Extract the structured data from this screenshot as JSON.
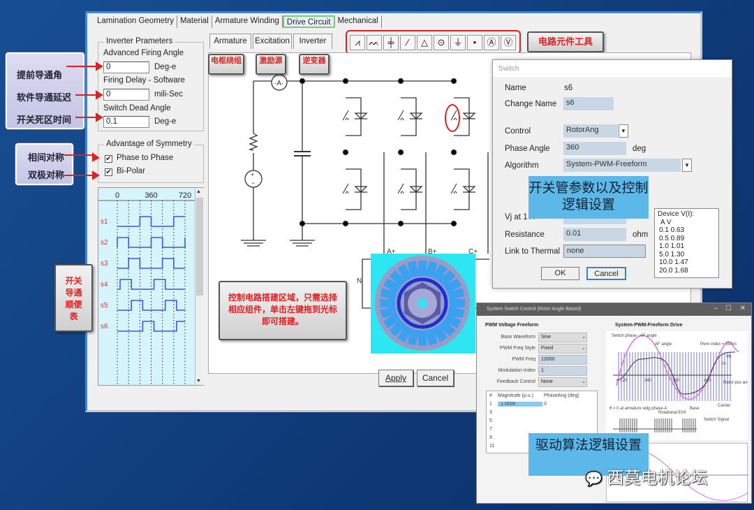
{
  "tabs": [
    {
      "label": "Lamination Geometry"
    },
    {
      "label": "Material"
    },
    {
      "label": "Armature Winding"
    },
    {
      "label": "Drive Circuit",
      "active": true
    },
    {
      "label": "Mechanical"
    }
  ],
  "inverter": {
    "title": "Inverter Prameters",
    "adv_label": "Advanced Firing Angle",
    "adv_value": "0",
    "adv_unit": "Deg-e",
    "delay_label": "Firing Delay - Software",
    "delay_value": "0",
    "delay_unit": "mili-Sec",
    "dead_label": "Switch Dead Angle",
    "dead_value": "0.1",
    "dead_unit": "Deg-e"
  },
  "symmetry": {
    "title": "Advantage of Symmetry",
    "phase_label": "Phase to Phase",
    "phase_checked": true,
    "bipolar_label": "Bi-Polar",
    "bipolar_checked": true
  },
  "switch_table": {
    "ticks": [
      "0",
      "360",
      "720"
    ],
    "rows": [
      {
        "name": "s1",
        "on": [
          [
            240,
            360
          ],
          [
            600,
            720
          ]
        ]
      },
      {
        "name": "s2",
        "on": [
          [
            0,
            120
          ],
          [
            360,
            480
          ],
          [
            720,
            720
          ]
        ]
      },
      {
        "name": "s3",
        "on": [
          [
            120,
            240
          ],
          [
            480,
            600
          ]
        ]
      },
      {
        "name": "s4",
        "on": [
          [
            30,
            150
          ],
          [
            390,
            510
          ]
        ]
      },
      {
        "name": "s5",
        "on": [
          [
            150,
            270
          ],
          [
            510,
            630
          ]
        ]
      },
      {
        "name": "s6",
        "on": [
          [
            270,
            390
          ],
          [
            630,
            720
          ]
        ]
      }
    ],
    "wave_color": "#3a5ad8"
  },
  "subtabs": [
    {
      "label": "Armature"
    },
    {
      "label": "Excitation"
    },
    {
      "label": "Inverter"
    }
  ],
  "subtab_callouts": [
    "电枢绕组",
    "激励源",
    "逆变器"
  ],
  "tools": [
    {
      "icon": "resistor-icon",
      "glyph": "⩘"
    },
    {
      "icon": "inductor-icon",
      "glyph": "ᨓ"
    },
    {
      "icon": "capacitor-icon",
      "glyph": "╪"
    },
    {
      "icon": "switch-icon",
      "glyph": "⁄"
    },
    {
      "icon": "diode-icon",
      "glyph": "△"
    },
    {
      "icon": "voltage-source-icon",
      "glyph": "⊙"
    },
    {
      "icon": "ground-icon",
      "glyph": "⏚"
    },
    {
      "icon": "node-icon",
      "glyph": "•"
    },
    {
      "icon": "ammeter-icon",
      "glyph": "Ⓐ"
    },
    {
      "icon": "voltmeter-icon",
      "glyph": "Ⓥ"
    }
  ],
  "tool_callout": "电路元件工具",
  "circuit": {
    "ammeter": "A",
    "terminals": [
      "A+",
      "B+",
      "C+"
    ],
    "neutral": "N"
  },
  "canvas_callout": "控制电路搭建区域，只需选择相应组件，单击左键拖到光标即可搭建。",
  "apply_label": "Apply",
  "cancel_label": "Cancel",
  "left_callouts": {
    "group1": [
      "提前导通角",
      "软件导通延迟",
      "开关死区时间"
    ],
    "group2": [
      "相间对称",
      "双极对称"
    ],
    "group3": "开关导通顺便表"
  },
  "switch_dialog": {
    "title": "Switch",
    "name_label": "Name",
    "name_value": "s6",
    "change_label": "Change Name",
    "change_value": "s6",
    "control_label": "Control",
    "control_value": "RotorAng",
    "phase_label": "Phase Angle",
    "phase_value": "360",
    "phase_unit": "deg",
    "algo_label": "Algorithm",
    "algo_value": "System-PWM-Freeform",
    "vj_label": "Vj at 1 A",
    "res_label": "Resistance",
    "res_value": "0.01",
    "res_unit": "ohm",
    "thermal_label": "Link to Thermal",
    "thermal_value": "none",
    "ok": "OK",
    "cancel": "Cancel",
    "device_title": "Device V(I):",
    "device_header": "A   V",
    "device_rows": [
      "0.1  0.63",
      "0.5  0.89",
      "1.0  1.01",
      "5.0  1.30",
      "10.0  1.47",
      "20.0  1.68"
    ]
  },
  "overlay1": "开关管参数以及控制逻辑设置",
  "ssc": {
    "title": "System Switch Control (Rotor Angle Based)",
    "left_title": "PWM Voltage Freeform",
    "fields": [
      {
        "label": "Base Waveform",
        "value": "Sine",
        "dropdown": true
      },
      {
        "label": "PWM Freq Style",
        "value": "Fixed",
        "dropdown": true
      },
      {
        "label": "PWM Freq",
        "value": "12000",
        "dropdown": false
      },
      {
        "label": "Modulation Index",
        "value": "1",
        "dropdown": false
      },
      {
        "label": "Feedback Control",
        "value": "None",
        "dropdown": true
      }
    ],
    "table_headers": [
      "#",
      "Magnitude (p.u.)",
      "PhaseAng (deg)"
    ],
    "table_rows": [
      [
        "1",
        "1.0000",
        "0"
      ],
      [
        "3",
        "",
        ""
      ],
      [
        "5",
        "",
        ""
      ],
      [
        "7",
        "",
        ""
      ],
      [
        "9",
        "",
        ""
      ],
      [
        "11",
        "",
        ""
      ]
    ],
    "right_title": "System-PWM-Freeform Drive",
    "diagram_labels": {
      "a": "Switch phase - AF angle",
      "b": "AF angle",
      "c": "Pwm index = Vb/Vc",
      "d": "Vb",
      "e": "Vc",
      "f": "Rotor pos angle, θ",
      "g": "θ = 0 at armature wdg phase-A",
      "h": "Rotational Emf",
      "i": "Base",
      "j": "Carrier",
      "k": "Switch Signal",
      "t1": "120",
      "t2": "240",
      "t3": "360",
      "t4": "480"
    }
  },
  "overlay2": "驱动算法逻辑设置",
  "watermark": "西莫电机论坛"
}
